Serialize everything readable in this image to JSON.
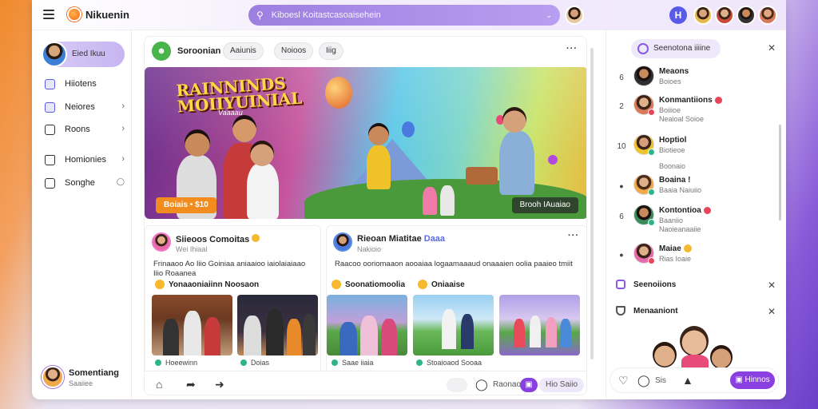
{
  "topbar": {
    "brand": "Nikuenin",
    "search_placeholder": "Kiboesl Koitastcasoaisehein"
  },
  "sidebar": {
    "profile_label": "Eied Ikuu",
    "items": [
      {
        "label": "Hiiotens",
        "chevron": false
      },
      {
        "label": "Neiores",
        "chevron": true
      },
      {
        "label": "Roons",
        "chevron": true
      },
      {
        "label": "Homionies",
        "chevron": true
      },
      {
        "label": "Songhe",
        "chevron": false
      }
    ],
    "user": {
      "name": "Somentiang",
      "status": "Saaiiee"
    }
  },
  "feed": {
    "title": "Soroonian",
    "chips": [
      "Aaiunis",
      "Noioos",
      "Iiig"
    ],
    "hero": {
      "title_line1": "RAINNINDS",
      "title_line2": "MOIIYUINIAL",
      "tagline": "Vaaaau",
      "price": "Boiais • $10",
      "cta": "Brooh IAuaiao"
    },
    "post1": {
      "name": "Siieoos Comoitas",
      "sub": "Wei Ihiaal",
      "body": "Frinaaoo Ao Iiio Goiniaa aniaaioo iaiolaiaiaao Iiio Roaanea",
      "tag": "Yonaaoniaiinn Noosaon",
      "photos": [
        "Hoeewinn",
        "Doias"
      ]
    },
    "post2": {
      "name": "Rieoan Miatitae",
      "badge": "Daaa",
      "sub": "Nakioio",
      "body": "Raacoo ooriomaaon aooaiaa logaamaaaud onaaaien oolia paaieo tmiit",
      "tag1": "Soonatiomoolia",
      "tag2": "Oniaaise",
      "photos": [
        "Saae iiaia",
        "Stoaioaod Sooaa"
      ]
    },
    "bottom": {
      "pill1": "Raonao",
      "pill2": "Hio Saiio"
    }
  },
  "rpanel": {
    "header": "Seenotona iiiine",
    "contacts": [
      {
        "num": "6",
        "name": "Meaons",
        "sub": "Boioes",
        "detail": "",
        "red": false,
        "status": "#2e2e2e"
      },
      {
        "num": "2",
        "name": "Konmantiions",
        "sub": "Boiiioe",
        "detail": "Neaioal Soioe",
        "red": true,
        "status": "#e8445a"
      },
      {
        "num": "10",
        "name": "Hoptiol",
        "sub": "Biotieoe",
        "detail": "Boonaio",
        "red": false,
        "status": "#2fb48a"
      },
      {
        "num": "",
        "name": "Boaina !",
        "sub": "Baaia Naiuiio",
        "detail": "",
        "red": false,
        "status": "#2fb48a"
      },
      {
        "num": "6",
        "name": "Kontontioa",
        "sub": "Baaniio",
        "detail": "Naoieanaaiie",
        "red": true,
        "status": "#2fb48a"
      },
      {
        "num": "",
        "name": "Maiae",
        "sub": "Rias Ioaie",
        "detail": "",
        "red": false,
        "status": "#e8445a"
      }
    ],
    "section1": "Seenoiions",
    "section2": "Menaaniont",
    "input_label": "Sis",
    "send_label": "Hinnos"
  }
}
